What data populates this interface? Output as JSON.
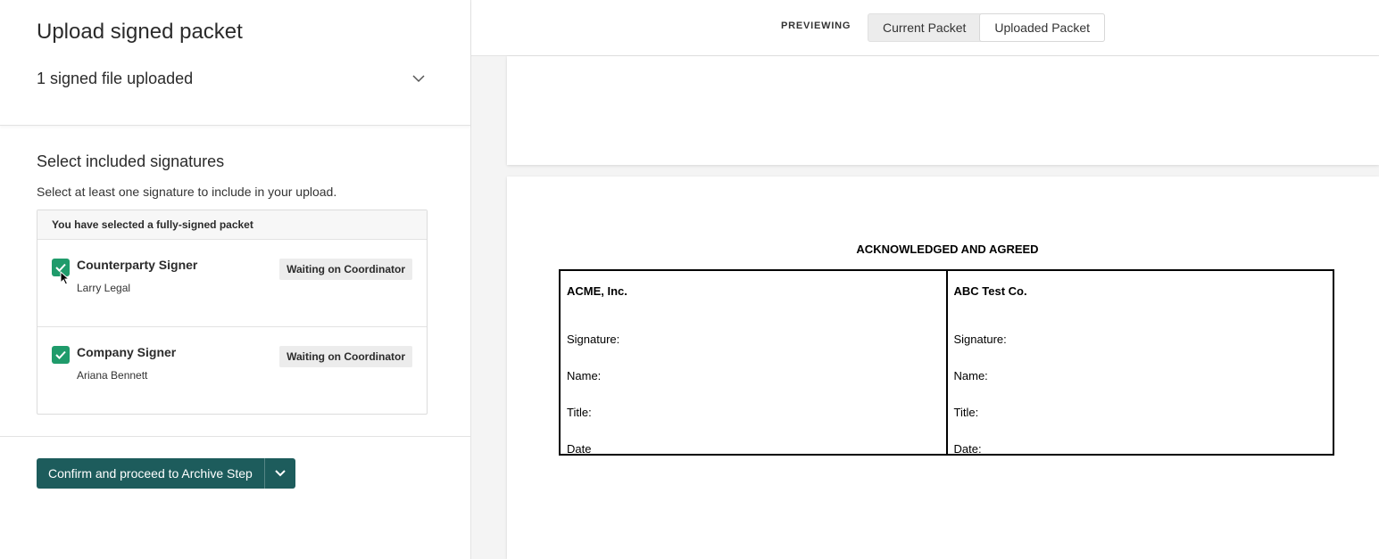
{
  "left": {
    "title": "Upload signed packet",
    "files_summary": "1 signed file uploaded",
    "section_title": "Select included signatures",
    "section_subtitle": "Select at least one signature to include in your upload.",
    "box_header": "You have selected a fully-signed packet",
    "signers": [
      {
        "role": "Counterparty Signer",
        "name": "Larry Legal",
        "status": "Waiting on Coordinator",
        "checked": true
      },
      {
        "role": "Company Signer",
        "name": "Ariana Bennett",
        "status": "Waiting on Coordinator",
        "checked": true
      }
    ],
    "confirm_label": "Confirm and proceed to Archive Step"
  },
  "preview": {
    "label": "PREVIEWING",
    "tabs": [
      {
        "label": "Current Packet",
        "active": false
      },
      {
        "label": "Uploaded Packet",
        "active": true
      }
    ],
    "doc": {
      "heading": "ACKNOWLEDGED AND AGREED",
      "left_party": "ACME, Inc.",
      "right_party": "ABC Test Co.",
      "left_fields": [
        "Signature:",
        "Name:",
        "Title:",
        "Date"
      ],
      "right_fields": [
        "Signature:",
        "Name:",
        "Title:",
        "Date:"
      ]
    }
  },
  "colors": {
    "checkbox": "#1f9b6b",
    "primary_button": "#1d5c5c"
  }
}
